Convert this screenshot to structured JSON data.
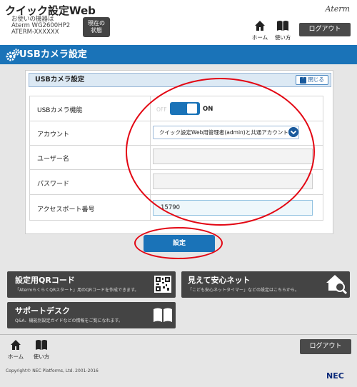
{
  "header": {
    "app_title": "クイック設定Web",
    "device_label": "お使いの機器は",
    "device_model": "Aterm WG2600HP2",
    "device_name": "ATERM-XXXXXX",
    "status_button": {
      "line1": "現在の",
      "line2": "状態"
    },
    "brand": "Aterm",
    "home_label": "ホーム",
    "help_label": "使い方",
    "logout_label": "ログアウト"
  },
  "page": {
    "title": "USBカメラ設定"
  },
  "section": {
    "title": "USBカメラ設定",
    "collapse_label": "閉じる"
  },
  "form": {
    "rows": [
      {
        "label": "USBカメラ機能"
      },
      {
        "label": "アカウント"
      },
      {
        "label": "ユーザー名"
      },
      {
        "label": "パスワード"
      },
      {
        "label": "アクセスポート番号"
      }
    ],
    "toggle": {
      "off_label": "OFF",
      "on_label": "ON",
      "state": "on"
    },
    "account_value": "クイック設定Web用管理者(admin)と共通アカウント",
    "username_value": "",
    "password_value": "",
    "port_value": "15790",
    "submit_label": "設定"
  },
  "tiles": [
    {
      "title": "設定用QRコード",
      "subtitle": "「AtermらくらくQRスタート」用のQRコードを作成できます。",
      "icon": "qr-code-icon"
    },
    {
      "title": "見えて安心ネット",
      "subtitle": "「こども安心ネットタイマー」などの設定はこちらから。",
      "icon": "house-magnifier-icon"
    },
    {
      "title": "サポートデスク",
      "subtitle": "Q&A、機能別設定ガイドなどの情報をご覧になれます。",
      "icon": "book-icon"
    }
  ],
  "footer": {
    "home_label": "ホーム",
    "help_label": "使い方",
    "logout_label": "ログアウト",
    "copyright": "Copyright© NEC Platforms, Ltd. 2001-2016",
    "logo": "NEC"
  },
  "colors": {
    "accent": "#1a73b8",
    "highlight_ring": "#e30613",
    "tile_bg": "#444444"
  }
}
